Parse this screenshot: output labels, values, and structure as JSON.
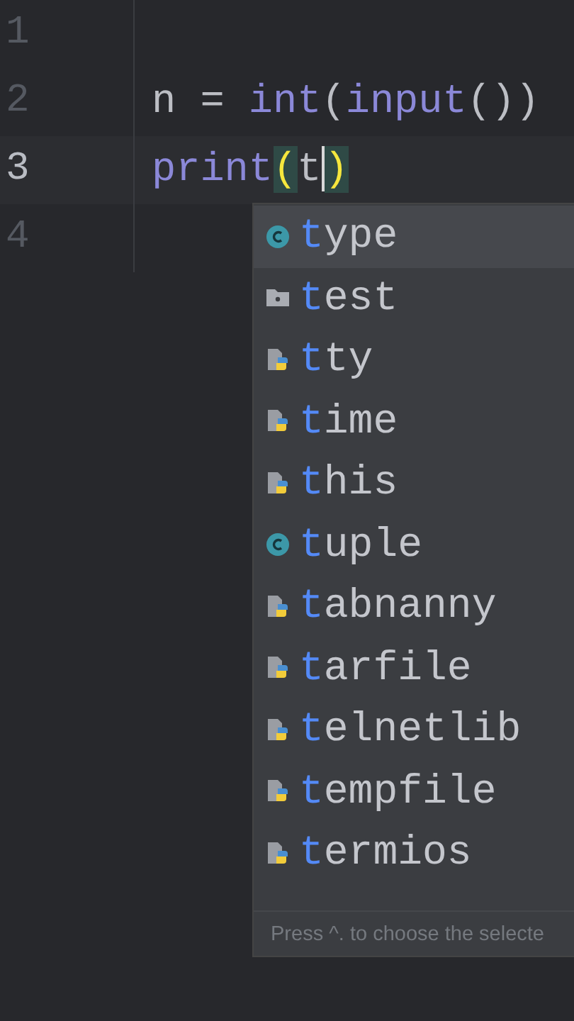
{
  "editor": {
    "lines": [
      {
        "number": "1",
        "current": false
      },
      {
        "number": "2",
        "current": false,
        "tokens": [
          {
            "kind": "name",
            "text": "n"
          },
          {
            "kind": "op",
            "text": " = "
          },
          {
            "kind": "builtin",
            "text": "int"
          },
          {
            "kind": "op",
            "text": "("
          },
          {
            "kind": "builtin",
            "text": "input"
          },
          {
            "kind": "op",
            "text": "())"
          }
        ]
      },
      {
        "number": "3",
        "current": true,
        "tokens": [
          {
            "kind": "builtin",
            "text": "print"
          },
          {
            "kind": "brace",
            "text": "("
          },
          {
            "kind": "name",
            "text": "t",
            "cursor": true
          },
          {
            "kind": "brace",
            "text": ")"
          }
        ]
      },
      {
        "number": "4",
        "current": false
      }
    ]
  },
  "completion": {
    "items": [
      {
        "kind": "class",
        "match": "t",
        "rest": "ype",
        "selected": true
      },
      {
        "kind": "folder",
        "match": "t",
        "rest": "est",
        "selected": false
      },
      {
        "kind": "module",
        "match": "t",
        "rest": "ty",
        "selected": false
      },
      {
        "kind": "module",
        "match": "t",
        "rest": "ime",
        "selected": false
      },
      {
        "kind": "module",
        "match": "t",
        "rest": "his",
        "selected": false
      },
      {
        "kind": "class",
        "match": "t",
        "rest": "uple",
        "selected": false
      },
      {
        "kind": "module",
        "match": "t",
        "rest": "abnanny",
        "selected": false
      },
      {
        "kind": "module",
        "match": "t",
        "rest": "arfile",
        "selected": false
      },
      {
        "kind": "module",
        "match": "t",
        "rest": "elnetlib",
        "selected": false
      },
      {
        "kind": "module",
        "match": "t",
        "rest": "empfile",
        "selected": false
      },
      {
        "kind": "module",
        "match": "t",
        "rest": "ermios",
        "selected": false
      }
    ],
    "hint": "Press ^. to choose the selecte"
  }
}
